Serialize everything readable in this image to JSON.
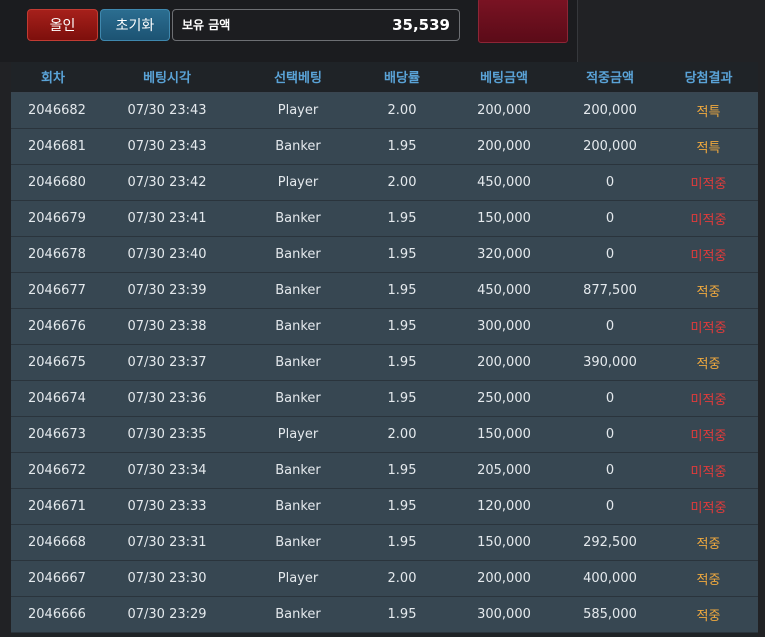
{
  "controls": {
    "bet_label": "올인",
    "reset_label": "초기화",
    "balance_label": "보유 금액",
    "balance_value": "35,539"
  },
  "table": {
    "headers": [
      "회차",
      "베팅시각",
      "선택베팅",
      "배당률",
      "베팅금액",
      "적중금액",
      "당첨결과"
    ],
    "rows": [
      [
        "2046682",
        "07/30 23:43",
        "Player",
        "2.00",
        "200,000",
        "200,000",
        "적특"
      ],
      [
        "2046681",
        "07/30 23:43",
        "Banker",
        "1.95",
        "200,000",
        "200,000",
        "적특"
      ],
      [
        "2046680",
        "07/30 23:42",
        "Player",
        "2.00",
        "450,000",
        "0",
        "미적중"
      ],
      [
        "2046679",
        "07/30 23:41",
        "Banker",
        "1.95",
        "150,000",
        "0",
        "미적중"
      ],
      [
        "2046678",
        "07/30 23:40",
        "Banker",
        "1.95",
        "320,000",
        "0",
        "미적중"
      ],
      [
        "2046677",
        "07/30 23:39",
        "Banker",
        "1.95",
        "450,000",
        "877,500",
        "적중"
      ],
      [
        "2046676",
        "07/30 23:38",
        "Banker",
        "1.95",
        "300,000",
        "0",
        "미적중"
      ],
      [
        "2046675",
        "07/30 23:37",
        "Banker",
        "1.95",
        "200,000",
        "390,000",
        "적중"
      ],
      [
        "2046674",
        "07/30 23:36",
        "Banker",
        "1.95",
        "250,000",
        "0",
        "미적중"
      ],
      [
        "2046673",
        "07/30 23:35",
        "Player",
        "2.00",
        "150,000",
        "0",
        "미적중"
      ],
      [
        "2046672",
        "07/30 23:34",
        "Banker",
        "1.95",
        "205,000",
        "0",
        "미적중"
      ],
      [
        "2046671",
        "07/30 23:33",
        "Banker",
        "1.95",
        "120,000",
        "0",
        "미적중"
      ],
      [
        "2046668",
        "07/30 23:31",
        "Banker",
        "1.95",
        "150,000",
        "292,500",
        "적중"
      ],
      [
        "2046667",
        "07/30 23:30",
        "Player",
        "2.00",
        "200,000",
        "400,000",
        "적중"
      ],
      [
        "2046666",
        "07/30 23:29",
        "Banker",
        "1.95",
        "300,000",
        "585,000",
        "적중"
      ]
    ]
  },
  "colors": {
    "header_text": "#5aa3d7",
    "row_bg": "#374752",
    "result_win": "#f0a93e",
    "result_lose": "#e23b3b"
  }
}
